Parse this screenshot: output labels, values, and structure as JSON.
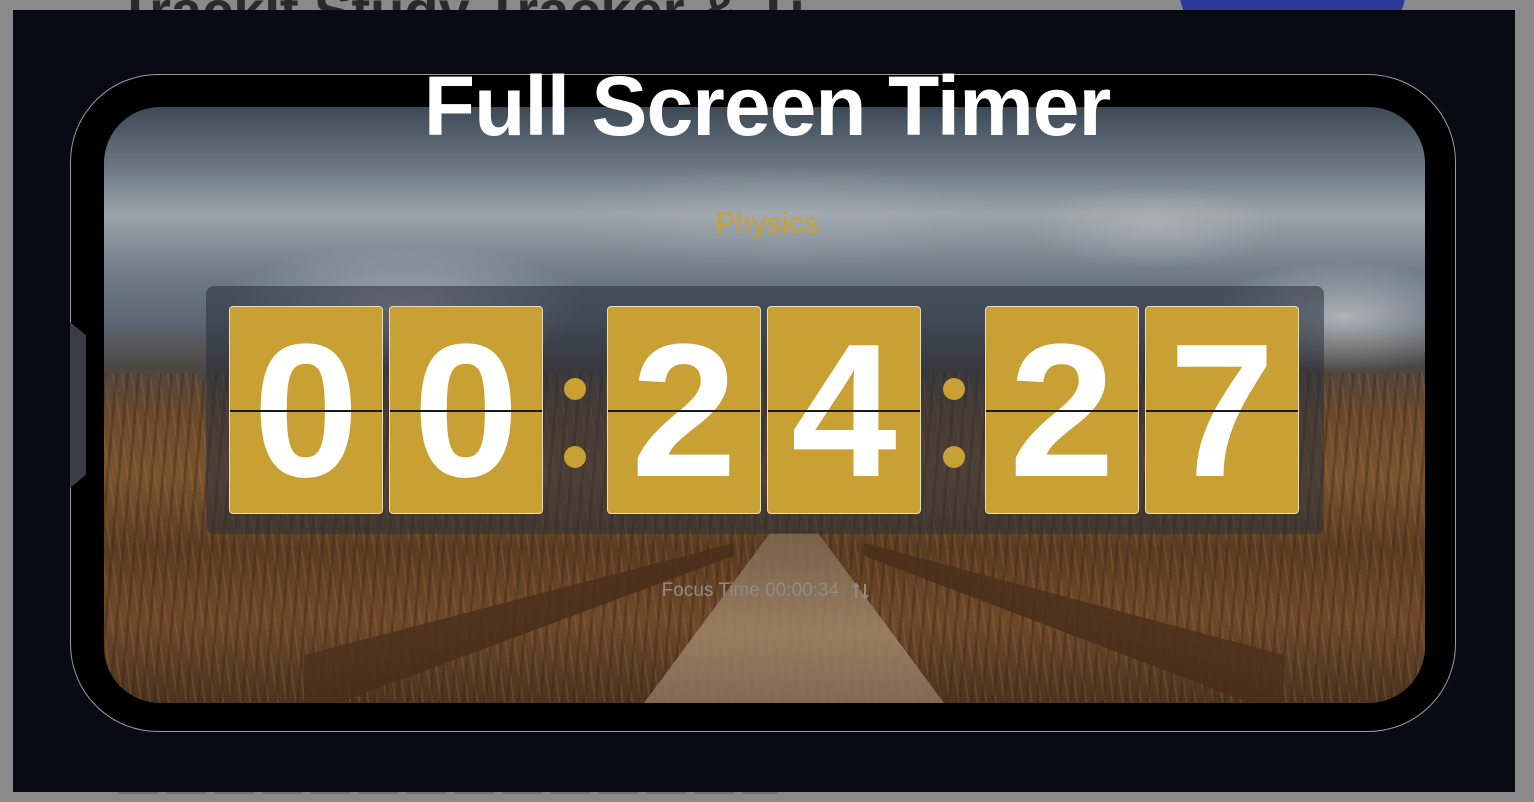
{
  "behind": {
    "title": "TrackIt Study Tracker & Ti"
  },
  "overlay": {
    "headline": "Full Screen Timer"
  },
  "timer": {
    "subject": "Physics",
    "hours": [
      "0",
      "0"
    ],
    "minutes": [
      "2",
      "4"
    ],
    "seconds": [
      "2",
      "7"
    ],
    "focus_label": "Focus Time 00:00:34"
  },
  "colors": {
    "accent": "#c9a033",
    "overlay_bg": "#080b14",
    "digit_text": "#ffffff"
  },
  "icons": [
    "swap-arrows-icon"
  ]
}
